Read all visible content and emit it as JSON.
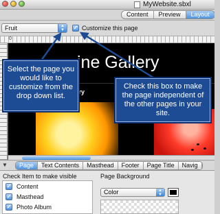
{
  "window": {
    "title": "MyWebsite.sbxl"
  },
  "toolbar": {
    "segments": [
      "Content",
      "Preview",
      "Layout"
    ],
    "active_segment": "Layout"
  },
  "page_selector": {
    "value": "Fruit"
  },
  "customize": {
    "label": "Customize this page",
    "checked": true
  },
  "ruler": {
    "origin": "0"
  },
  "canvas": {
    "gallery_title": "ine Gallery",
    "bar_text": "cenery"
  },
  "callouts": {
    "left": "Select the page you would like to customize from the drop down list.",
    "right": "Check this box to make the page independent of the other pages in your site."
  },
  "tabs": [
    "Page",
    "Text Contents",
    "Masthead",
    "Footer",
    "Page Title",
    "Navig"
  ],
  "active_tab": "Page",
  "inspector": {
    "visible_label": "Check Item to make visible",
    "visible_items": [
      "Content",
      "Masthead",
      "Photo Album"
    ],
    "background_label": "Page Background",
    "background_type": "Color",
    "background_color": "#000000"
  },
  "colors": {
    "callout_bg": "#1e4c94",
    "accent": "#4f93dd"
  }
}
